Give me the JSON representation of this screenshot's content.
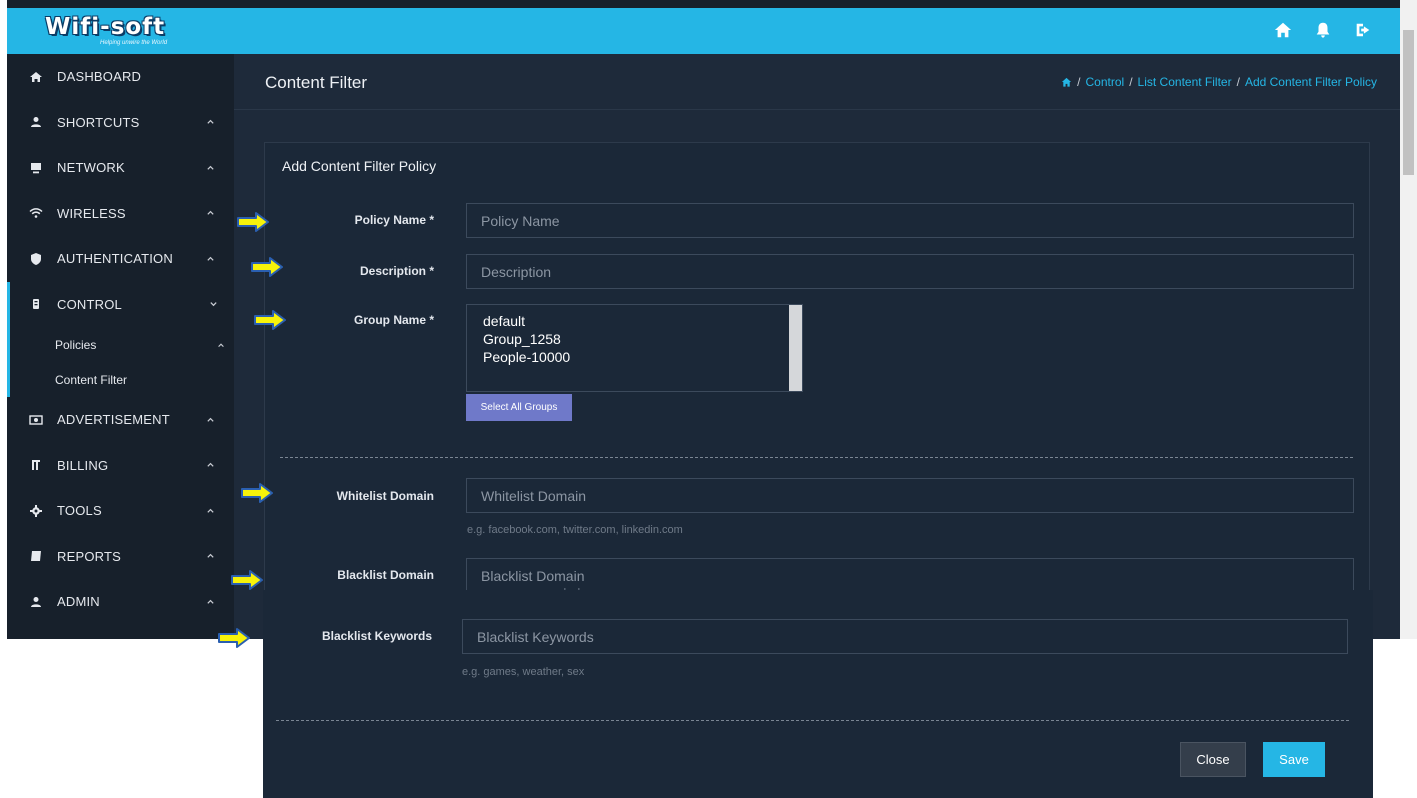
{
  "app": {
    "logo": {
      "name": "Wifi-soft",
      "tagline": "Helping unwire the World"
    },
    "top_icons": [
      "home-icon",
      "bell-icon",
      "logout-icon"
    ]
  },
  "sidebar": {
    "items": [
      {
        "label": "DASHBOARD",
        "icon": "home-icon"
      },
      {
        "label": "SHORTCUTS",
        "icon": "user-icon"
      },
      {
        "label": "NETWORK",
        "icon": "desktop-icon"
      },
      {
        "label": "WIRELESS",
        "icon": "wifi-icon"
      },
      {
        "label": "AUTHENTICATION",
        "icon": "shield-icon"
      },
      {
        "label": "CONTROL",
        "icon": "sliders-icon"
      },
      {
        "label": "ADVERTISEMENT",
        "icon": "money-icon"
      },
      {
        "label": "BILLING",
        "icon": "receipt-icon"
      },
      {
        "label": "TOOLS",
        "icon": "gear-icon"
      },
      {
        "label": "REPORTS",
        "icon": "book-icon"
      },
      {
        "label": "ADMIN",
        "icon": "user-icon"
      }
    ],
    "sub_items": [
      {
        "label": "Policies"
      },
      {
        "label": "Content Filter"
      }
    ]
  },
  "header": {
    "title": "Content Filter",
    "breadcrumb": [
      "Control",
      "List Content Filter",
      "Add Content Filter Policy"
    ],
    "sep": "/"
  },
  "form": {
    "title": "Add Content Filter Policy",
    "policy_name": {
      "label": "Policy Name *",
      "placeholder": "Policy Name"
    },
    "description": {
      "label": "Description *",
      "placeholder": "Description"
    },
    "group_name": {
      "label": "Group Name *",
      "options": [
        "default",
        "Group_1258",
        "People-10000"
      ],
      "select_all": "Select All Groups"
    },
    "whitelist": {
      "label": "Whitelist Domain",
      "placeholder": "Whitelist Domain",
      "help": "e.g. facebook.com, twitter.com, linkedin.com"
    },
    "blacklist_domain": {
      "label": "Blacklist Domain",
      "placeholder": "Blacklist Domain",
      "help": "e.g. amazon.com, playboy.com, games.com"
    },
    "blacklist_keywords": {
      "label": "Blacklist Keywords",
      "placeholder": "Blacklist Keywords",
      "help": "e.g. games, weather, sex"
    },
    "close_label": "Close",
    "save_label": "Save"
  },
  "colors": {
    "topbar": "#25b6e5",
    "sidebar": "#17202b",
    "content": "#1e2a3a",
    "card": "#1b2838",
    "arrow_fill": "#f7f20a",
    "arrow_stroke": "#2a5fb0"
  }
}
